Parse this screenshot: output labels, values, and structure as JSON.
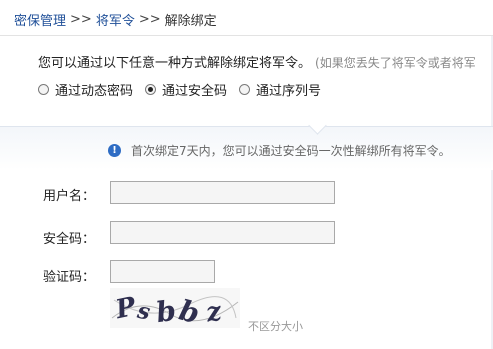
{
  "breadcrumb": {
    "item1": "密保管理",
    "sep1": ">>",
    "item2": "将军令",
    "sep2": ">>",
    "current": "解除绑定"
  },
  "intro": {
    "text": "您可以通过以下任意一种方式解除绑定将军令。",
    "hint": "(如果您丢失了将军令或者将军"
  },
  "methods": {
    "options": [
      "通过动态密码",
      "通过安全码",
      "通过序列号"
    ],
    "selected_index": 1
  },
  "notice": {
    "icon": "info-icon",
    "text": "首次绑定7天内，您可以通过安全码一次性解绑所有将军令。"
  },
  "form": {
    "username_label": "用户名：",
    "username_value": "",
    "security_code_label": "安全码：",
    "security_code_value": "",
    "captcha_label": "验证码：",
    "captcha_value": "",
    "captcha_image_text": "Psbbz",
    "refresh_hint": "不区分大小"
  }
}
